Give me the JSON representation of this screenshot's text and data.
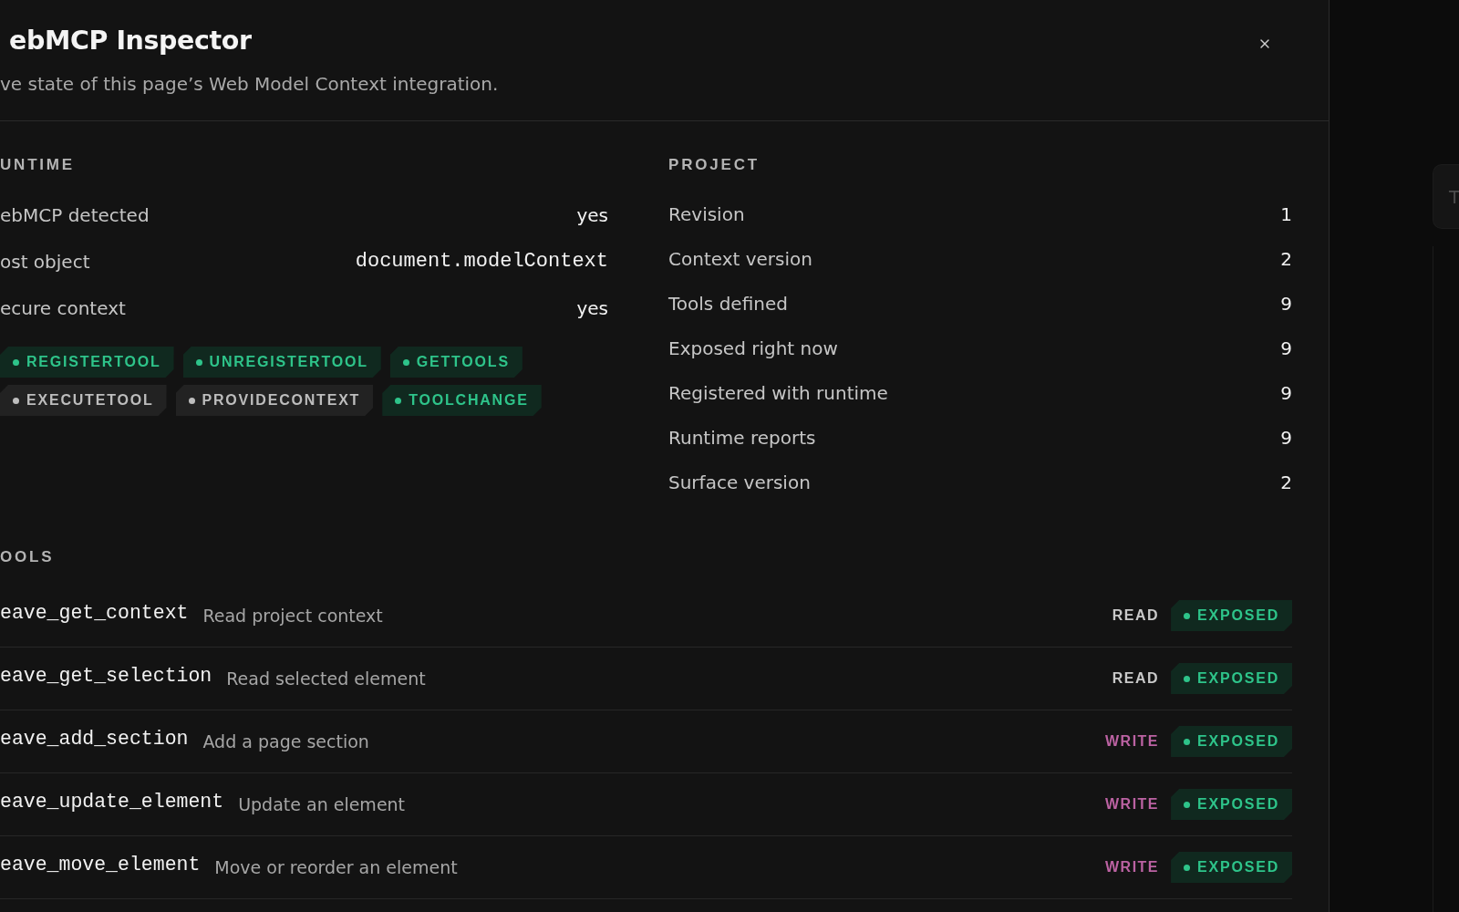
{
  "header": {
    "title": "ebMCP Inspector",
    "subtitle": "ve state of this page’s Web Model Context integration."
  },
  "runtime": {
    "heading": "UNTIME",
    "rows": [
      {
        "label": "ebMCP detected",
        "value": "yes",
        "kind": "text"
      },
      {
        "label": "ost object",
        "value": "document.modelContext",
        "kind": "code"
      },
      {
        "label": "ecure context",
        "value": "yes",
        "kind": "text"
      }
    ],
    "capabilities": [
      {
        "label": "REGISTERTOOL",
        "available": true
      },
      {
        "label": "UNREGISTERTOOL",
        "available": true
      },
      {
        "label": "GETTOOLS",
        "available": true
      },
      {
        "label": "EXECUTETOOL",
        "available": false
      },
      {
        "label": "PROVIDECONTEXT",
        "available": false
      },
      {
        "label": "TOOLCHANGE",
        "available": true
      }
    ]
  },
  "project": {
    "heading": "PROJECT",
    "rows": [
      {
        "label": "Revision",
        "value": "1"
      },
      {
        "label": "Context version",
        "value": "2"
      },
      {
        "label": "Tools defined",
        "value": "9"
      },
      {
        "label": "Exposed right now",
        "value": "9"
      },
      {
        "label": "Registered with runtime",
        "value": "9"
      },
      {
        "label": "Runtime reports",
        "value": "9"
      },
      {
        "label": "Surface version",
        "value": "2"
      }
    ]
  },
  "tools": {
    "heading": "OOLS",
    "rows": [
      {
        "name": "eave_get_context",
        "description": "Read project context",
        "access": {
          "label": "READ",
          "kind": "read"
        },
        "status": "EXPOSED",
        "exposed": true
      },
      {
        "name": "eave_get_selection",
        "description": "Read selected element",
        "access": {
          "label": "READ",
          "kind": "read"
        },
        "status": "EXPOSED",
        "exposed": true
      },
      {
        "name": "eave_add_section",
        "description": "Add a page section",
        "access": {
          "label": "WRITE",
          "kind": "write"
        },
        "status": "EXPOSED",
        "exposed": true
      },
      {
        "name": "eave_update_element",
        "description": "Update an element",
        "access": {
          "label": "WRITE",
          "kind": "write"
        },
        "status": "EXPOSED",
        "exposed": true
      },
      {
        "name": "eave_move_element",
        "description": "Move or reorder an element",
        "access": {
          "label": "WRITE",
          "kind": "write"
        },
        "status": "EXPOSED",
        "exposed": true
      }
    ]
  },
  "side_card": {
    "text": "T"
  }
}
